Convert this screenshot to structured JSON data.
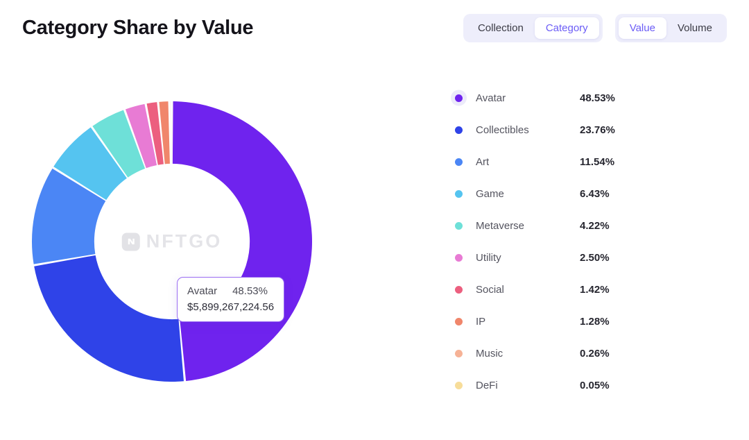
{
  "header": {
    "title": "Category Share by Value",
    "toggle_groups": [
      {
        "name": "scope",
        "options": [
          {
            "label": "Collection",
            "active": false
          },
          {
            "label": "Category",
            "active": true
          }
        ]
      },
      {
        "name": "metric",
        "options": [
          {
            "label": "Value",
            "active": true
          },
          {
            "label": "Volume",
            "active": false
          }
        ]
      }
    ]
  },
  "watermark": {
    "text": "NFTGO",
    "icon": "nftgo-logo-icon"
  },
  "tooltip": {
    "category": "Avatar",
    "percent": "48.53%",
    "value": "$5,899,267,224.56"
  },
  "chart_data": {
    "type": "pie",
    "title": "Category Share by Value",
    "subtitle": "",
    "xlabel": "",
    "ylabel": "",
    "donut": true,
    "inner_radius_ratio": 0.555,
    "start_angle_deg": 0,
    "direction": "clockwise",
    "legend_position": "right",
    "grid": false,
    "unit": "percent",
    "categories": [
      "Avatar",
      "Collectibles",
      "Art",
      "Game",
      "Metaverse",
      "Utility",
      "Social",
      "IP",
      "Music",
      "DeFi"
    ],
    "values": [
      48.53,
      23.76,
      11.54,
      6.43,
      4.22,
      2.5,
      1.42,
      1.28,
      0.26,
      0.05
    ],
    "labels": [
      "48.53%",
      "23.76%",
      "11.54%",
      "6.43%",
      "4.22%",
      "2.50%",
      "1.42%",
      "1.28%",
      "0.26%",
      "0.05%"
    ],
    "colors": [
      "#6f23ee",
      "#2f43e8",
      "#4b86f5",
      "#55c4f0",
      "#6ee0d8",
      "#e87bd4",
      "#ec5f7f",
      "#f0866b",
      "#f6b296",
      "#f7dd9a"
    ],
    "highlighted": "Avatar",
    "series": [
      {
        "name": "Category Share by Value",
        "points": [
          {
            "label": "Avatar",
            "value": 48.53,
            "display": "48.53%",
            "color": "#6f23ee"
          },
          {
            "label": "Collectibles",
            "value": 23.76,
            "display": "23.76%",
            "color": "#2f43e8"
          },
          {
            "label": "Art",
            "value": 11.54,
            "display": "11.54%",
            "color": "#4b86f5"
          },
          {
            "label": "Game",
            "value": 6.43,
            "display": "6.43%",
            "color": "#55c4f0"
          },
          {
            "label": "Metaverse",
            "value": 4.22,
            "display": "4.22%",
            "color": "#6ee0d8"
          },
          {
            "label": "Utility",
            "value": 2.5,
            "display": "2.50%",
            "color": "#e87bd4"
          },
          {
            "label": "Social",
            "value": 1.42,
            "display": "1.42%",
            "color": "#ec5f7f"
          },
          {
            "label": "IP",
            "value": 1.28,
            "display": "1.28%",
            "color": "#f0866b"
          },
          {
            "label": "Music",
            "value": 0.26,
            "display": "0.26%",
            "color": "#f6b296"
          },
          {
            "label": "DeFi",
            "value": 0.05,
            "display": "0.05%",
            "color": "#f7dd9a"
          }
        ]
      }
    ]
  },
  "legend": {
    "items": [
      {
        "label": "Avatar",
        "percent": "48.53%",
        "color": "#6f23ee",
        "hovered": true
      },
      {
        "label": "Collectibles",
        "percent": "23.76%",
        "color": "#2f43e8",
        "hovered": false
      },
      {
        "label": "Art",
        "percent": "11.54%",
        "color": "#4b86f5",
        "hovered": false
      },
      {
        "label": "Game",
        "percent": "6.43%",
        "color": "#55c4f0",
        "hovered": false
      },
      {
        "label": "Metaverse",
        "percent": "4.22%",
        "color": "#6ee0d8",
        "hovered": false
      },
      {
        "label": "Utility",
        "percent": "2.50%",
        "color": "#e87bd4",
        "hovered": false
      },
      {
        "label": "Social",
        "percent": "1.42%",
        "color": "#ec5f7f",
        "hovered": false
      },
      {
        "label": "IP",
        "percent": "1.28%",
        "color": "#f0866b",
        "hovered": false
      },
      {
        "label": "Music",
        "percent": "0.26%",
        "color": "#f6b296",
        "hovered": false
      },
      {
        "label": "DeFi",
        "percent": "0.05%",
        "color": "#f7dd9a",
        "hovered": false
      }
    ]
  }
}
